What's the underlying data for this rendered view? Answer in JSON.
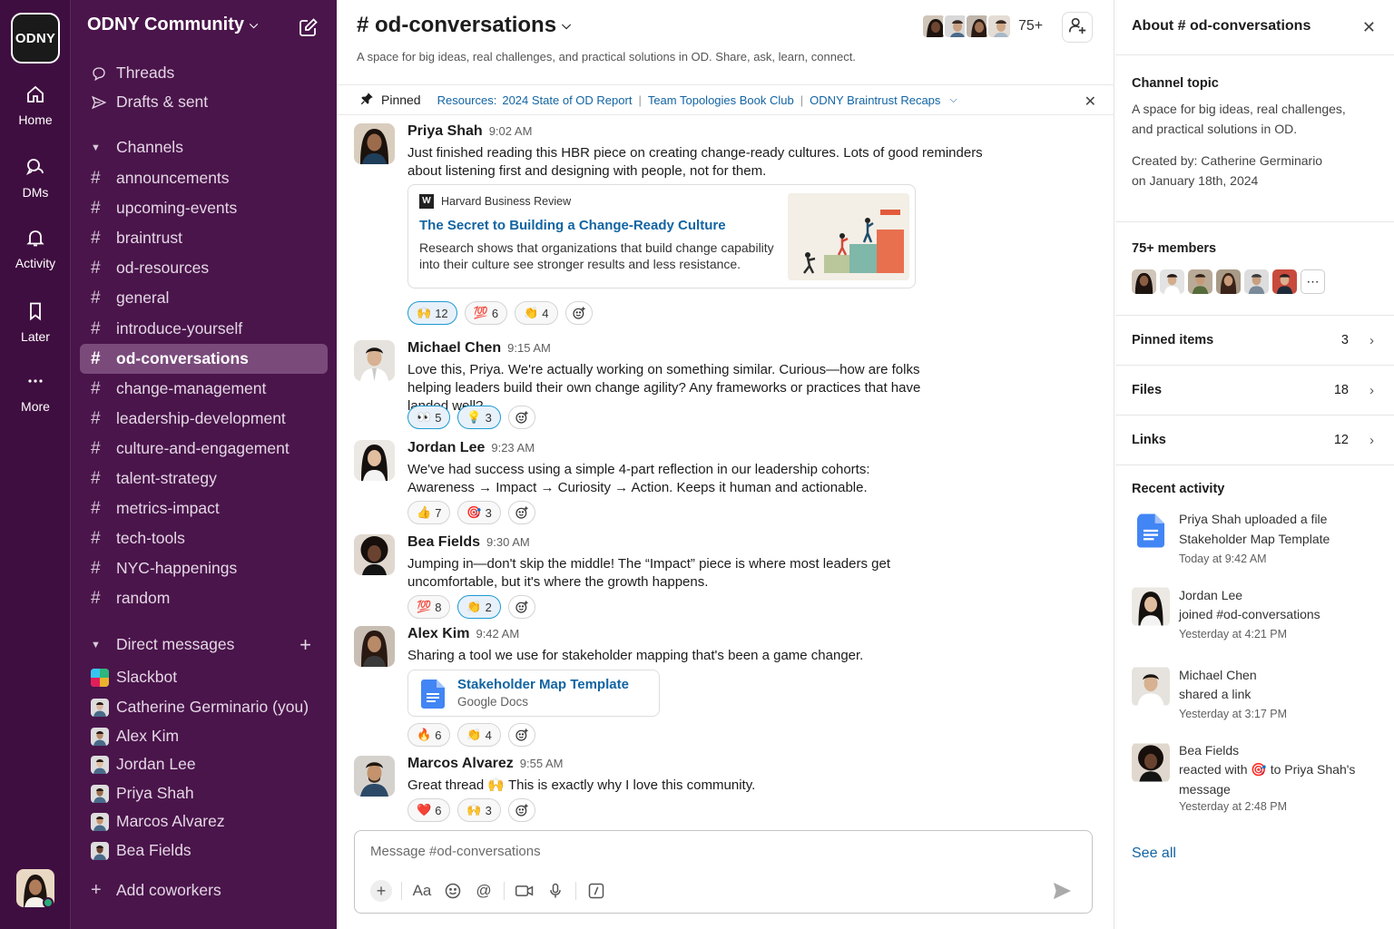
{
  "workspace": {
    "logo": "ODNY",
    "name": "ODNY Community"
  },
  "rail": [
    {
      "label": "Home",
      "icon": "home-icon"
    },
    {
      "label": "DMs",
      "icon": "dm-icon"
    },
    {
      "label": "Activity",
      "icon": "bell-icon"
    },
    {
      "label": "Later",
      "icon": "bookmark-icon"
    },
    {
      "label": "More",
      "icon": "more-icon"
    }
  ],
  "sidebar": {
    "threads": "Threads",
    "drafts": "Drafts & sent",
    "channels_header": "Channels",
    "channels": [
      "announcements",
      "upcoming-events",
      "braintrust",
      "od-resources",
      "general",
      "introduce-yourself",
      "od-conversations",
      "change-management",
      "leadership-development",
      "culture-and-engagement",
      "talent-strategy",
      "metrics-impact",
      "tech-tools",
      "NYC-happenings",
      "random"
    ],
    "active_channel": "od-conversations",
    "dm_header": "Direct messages",
    "dms": [
      "Slackbot",
      "Catherine Germinario  (you)",
      "Alex Kim",
      "Jordan Lee",
      "Priya Shah",
      "Marcos Alvarez",
      "Bea Fields"
    ],
    "add_coworkers": "Add coworkers"
  },
  "channel": {
    "title": "# od-conversations",
    "description": "A space for big ideas, real challenges, and practical solutions in OD. Share, ask, learn, connect.",
    "member_count": "75+"
  },
  "pinbar": {
    "label": "Pinned",
    "prefix": "Resources:",
    "links": [
      "2024 State of OD Report",
      "Team Topologies Book Club",
      "ODNY Braintrust Recaps"
    ]
  },
  "messages": [
    {
      "name": "Priya Shah",
      "time": "9:02 AM",
      "text": "Just finished reading this HBR piece on creating change-ready cultures. Lots of good reminders about listening first and designing with people, not for them.",
      "link": {
        "source": "Harvard Business Review",
        "title": "The Secret to Building a Change-Ready Culture",
        "desc": "Research shows that organizations that build change capability into their culture see stronger results and less resistance."
      },
      "reactions": [
        {
          "emoji": "🙌",
          "count": "12"
        },
        {
          "emoji": "💯",
          "count": "6"
        },
        {
          "emoji": "👏",
          "count": "4"
        }
      ]
    },
    {
      "name": "Michael Chen",
      "time": "9:15 AM",
      "text": "Love this, Priya. We're actually working on something similar.  Curious—how are folks helping leaders build their own change agility? Any frameworks or practices that have landed well?",
      "reactions": [
        {
          "emoji": "👀",
          "count": "5"
        },
        {
          "emoji": "💡",
          "count": "3"
        }
      ]
    },
    {
      "name": "Jordan Lee",
      "time": "9:23 AM",
      "text": "We've had success using a simple 4-part reflection in our leadership cohorts:",
      "text2": "Awareness → Impact → Curiosity → Action.   Keeps it human and actionable.",
      "reactions": [
        {
          "emoji": "👍",
          "count": "7"
        },
        {
          "emoji": "🎯",
          "count": "3"
        }
      ]
    },
    {
      "name": "Bea Fields",
      "time": "9:30 AM",
      "text": "Jumping in—don't skip the middle! The “Impact” piece is where most leaders get uncomfortable, but it's where the growth happens.",
      "reactions": [
        {
          "emoji": "💯",
          "count": "8"
        },
        {
          "emoji": "👏",
          "count": "2"
        }
      ]
    },
    {
      "name": "Alex Kim",
      "time": "9:42 AM",
      "text": "Sharing a tool we use for stakeholder mapping that's been a game changer.",
      "file": {
        "name": "Stakeholder Map Template",
        "type": "Google Docs"
      },
      "reactions": [
        {
          "emoji": "🔥",
          "count": "6"
        },
        {
          "emoji": "👏",
          "count": "4"
        }
      ]
    },
    {
      "name": "Marcos Alvarez",
      "time": "9:55 AM",
      "text": "Great thread 🙌  This is exactly why I love this community.",
      "reactions": [
        {
          "emoji": "❤️",
          "count": "6"
        },
        {
          "emoji": "🙌",
          "count": "3"
        }
      ]
    }
  ],
  "composer": {
    "placeholder": "Message #od-conversations",
    "format_label": "Aa"
  },
  "details": {
    "header": "About  # od-conversations",
    "topic_label": "Channel topic",
    "topic": "A space for big ideas, real challenges, and practical solutions in OD.",
    "created_by": "Created by: Catherine Germinario",
    "created_on": "on January 18th, 2024",
    "members_label": "75+ members",
    "rows": [
      {
        "label": "Pinned items",
        "count": "3"
      },
      {
        "label": "Files",
        "count": "18"
      },
      {
        "label": "Links",
        "count": "12"
      }
    ],
    "recent_label": "Recent activity",
    "activity": [
      {
        "line1": "Priya Shah uploaded a file",
        "line2": "Stakeholder Map Template",
        "time": "Today at 9:42 AM"
      },
      {
        "line1": "Jordan Lee",
        "line2": "joined #od-conversations",
        "time": "Yesterday at 4:21 PM"
      },
      {
        "line1": "Michael Chen",
        "line2": "shared a link",
        "time": "Yesterday at 3:17 PM"
      },
      {
        "line1": "Bea Fields",
        "line2": "reacted with 🎯  to Priya Shah's",
        "line3": "message",
        "time": "Yesterday at 2:48 PM"
      }
    ],
    "see_all": "See all"
  },
  "colors": {
    "rail": "#3f0e40",
    "sidebar": "#4a154b",
    "active": "#7a4a7b",
    "link": "#1264a3",
    "online": "#2bac76"
  }
}
